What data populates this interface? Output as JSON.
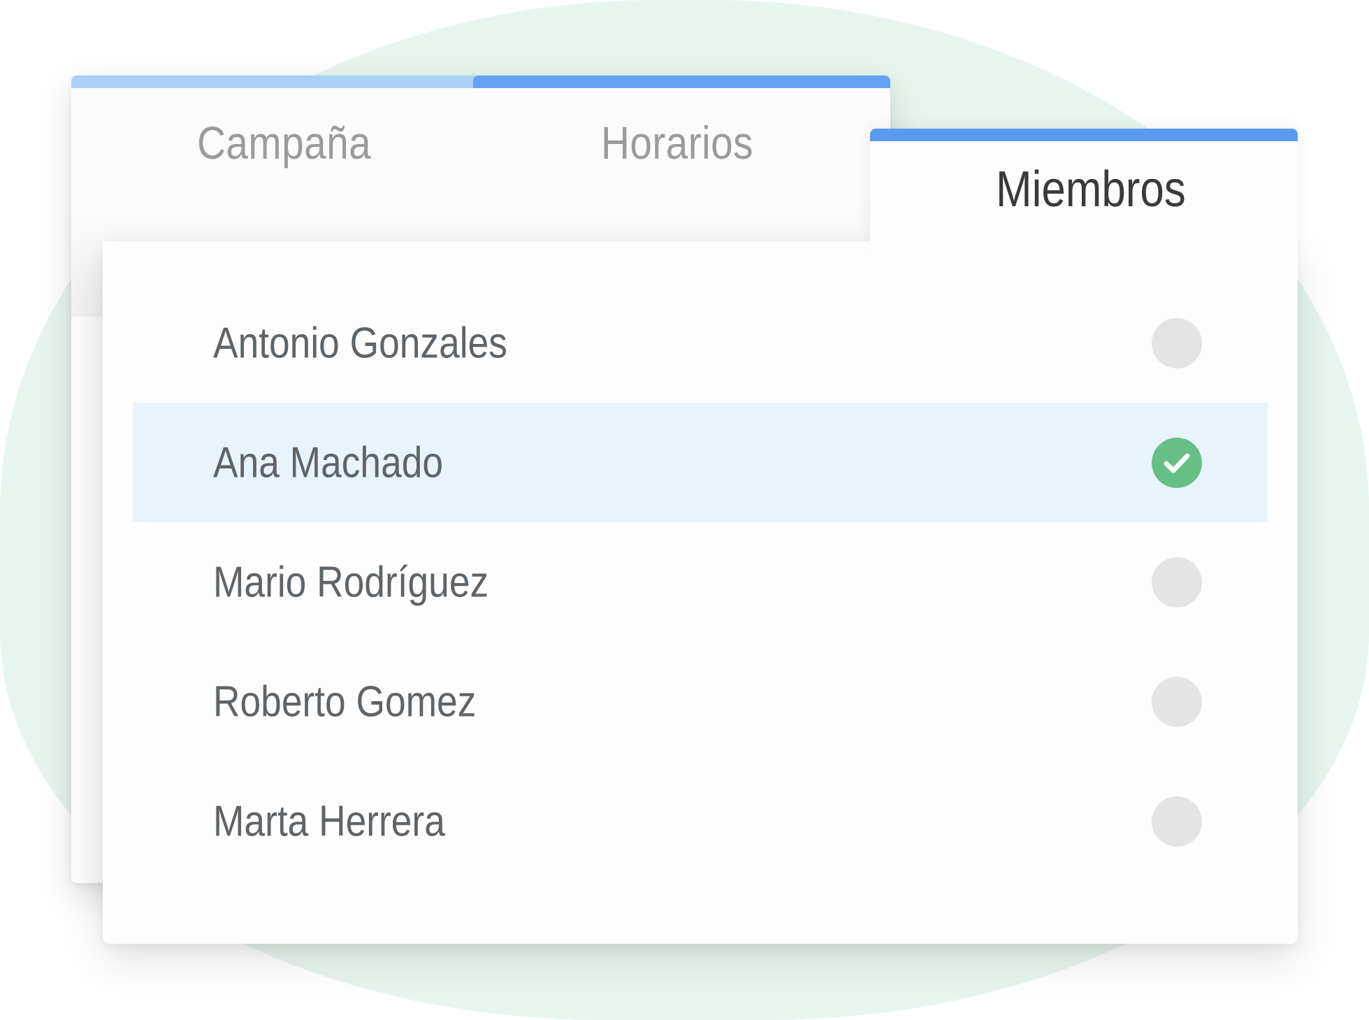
{
  "tabs": {
    "campana": "Campaña",
    "horarios": "Horarios",
    "miembros": "Miembros"
  },
  "active_tab": "Miembros",
  "members": [
    {
      "name": "Antonio Gonzales",
      "selected": false
    },
    {
      "name": "Ana Machado",
      "selected": true
    },
    {
      "name": "Mario Rodríguez",
      "selected": false
    },
    {
      "name": "Roberto Gomez",
      "selected": false
    },
    {
      "name": "Marta Herrera",
      "selected": false
    }
  ],
  "icons": {
    "unchecked": "unchecked-circle-icon",
    "checked": "check-circle-icon"
  },
  "colors": {
    "background_blob": "#e6f6ee",
    "tab_campana_bar": "#a9d1f7",
    "tab_horarios_bar": "#65a3f2",
    "tab_miembros_bar": "#5a9bf1",
    "selected_row": "#e9f3fc",
    "check_green": "#66bf84",
    "unchecked_gray": "#e4e4e4"
  }
}
